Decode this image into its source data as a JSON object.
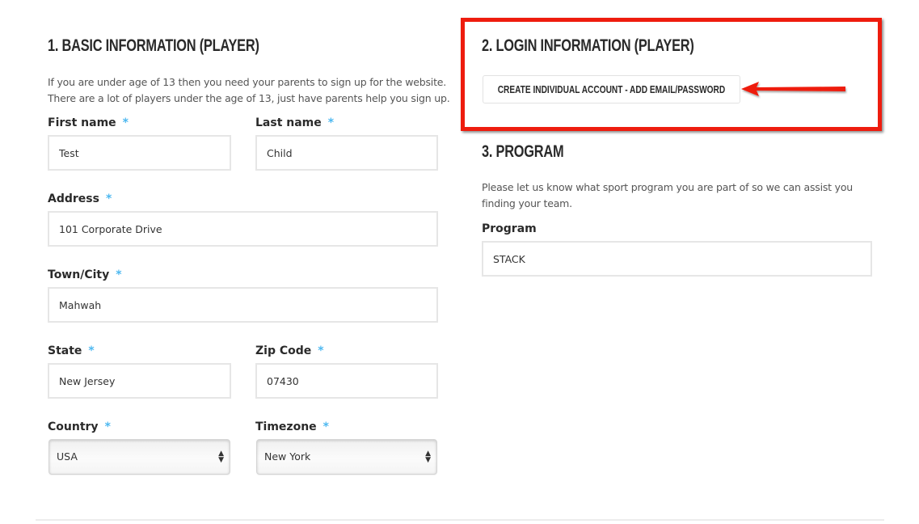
{
  "basic_info": {
    "heading": "1. BASIC INFORMATION (PLAYER)",
    "description_line1": "If you are under age of 13 then you need your parents to sign up for the website.",
    "description_line2": "There are a lot of players under the age of 13, just have parents help you sign up.",
    "required_marker": "*",
    "fields": {
      "first_name": {
        "label": "First name",
        "value": "Test"
      },
      "last_name": {
        "label": "Last name",
        "value": "Child"
      },
      "address": {
        "label": "Address",
        "value": "101 Corporate Drive"
      },
      "town_city": {
        "label": "Town/City",
        "value": "Mahwah"
      },
      "state": {
        "label": "State",
        "value": "New Jersey"
      },
      "zip_code": {
        "label": "Zip Code",
        "value": "07430"
      },
      "country": {
        "label": "Country",
        "selected": "USA"
      },
      "timezone": {
        "label": "Timezone",
        "selected": "New York"
      }
    }
  },
  "login_info": {
    "heading": "2. LOGIN INFORMATION (PLAYER)",
    "create_account_button": "CREATE INDIVIDUAL ACCOUNT - ADD EMAIL/PASSWORD",
    "annotation_color": "#ee1c0e"
  },
  "program": {
    "heading": "3. PROGRAM",
    "description_line1": "Please let us know what sport program you are part of so we can assist you",
    "description_line2": "finding your team.",
    "field": {
      "label": "Program",
      "value": "STACK"
    }
  },
  "colors": {
    "required_asterisk": "#4db8f0",
    "field_border": "#e6e6e6"
  }
}
